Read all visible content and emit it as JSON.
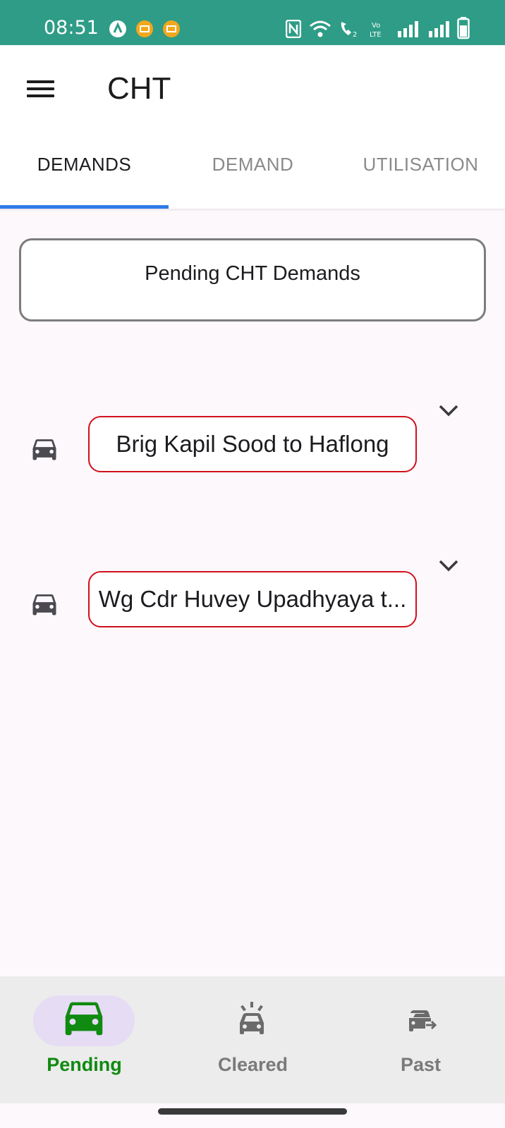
{
  "status_bar": {
    "time": "08:51"
  },
  "app_bar": {
    "title": "CHT",
    "menu_icon": "menu-icon"
  },
  "tabs": [
    {
      "label": "DEMANDS",
      "active": true
    },
    {
      "label": "DEMAND",
      "active": false
    },
    {
      "label": "UTILISATION",
      "active": false
    }
  ],
  "section": {
    "title": "Pending CHT Demands"
  },
  "demands": [
    {
      "label": "Brig Kapil Sood to Haflong",
      "icon": "car-icon"
    },
    {
      "label": "Wg Cdr Huvey Upadhyaya t...",
      "icon": "car-icon"
    }
  ],
  "bottom_nav": [
    {
      "label": "Pending",
      "icon": "car-icon",
      "active": true
    },
    {
      "label": "Cleared",
      "icon": "car-siren-icon",
      "active": false
    },
    {
      "label": "Past",
      "icon": "car-arrow-icon",
      "active": false
    }
  ],
  "colors": {
    "status_bar": "#2e9c86",
    "tab_indicator": "#2f7be8",
    "chip_border": "#d0111c",
    "active_nav": "#108a10",
    "active_pill": "#e6dcf4"
  }
}
